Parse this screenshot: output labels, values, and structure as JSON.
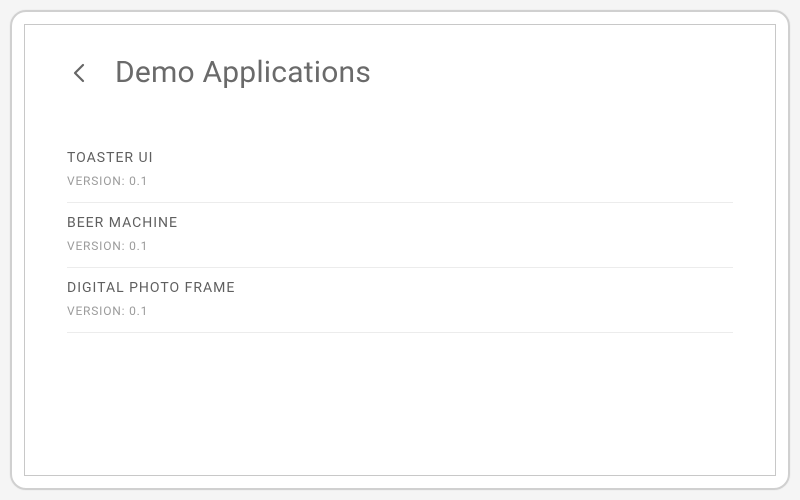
{
  "header": {
    "title": "Demo Applications"
  },
  "apps": [
    {
      "name": "TOASTER UI",
      "version": "VERSION: 0.1"
    },
    {
      "name": "BEER MACHINE",
      "version": "VERSION: 0.1"
    },
    {
      "name": "DIGITAL PHOTO FRAME",
      "version": "VERSION: 0.1"
    }
  ]
}
